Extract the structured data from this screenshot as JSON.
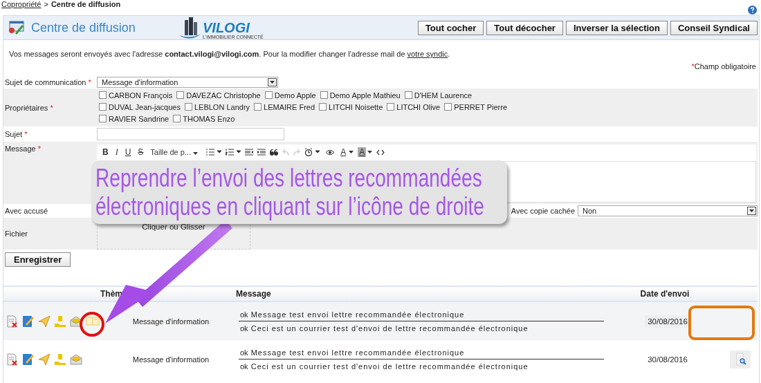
{
  "breadcrumb": {
    "parent": "Copropriété",
    "separator": ">",
    "current": "Centre de diffusion"
  },
  "header": {
    "title": "Centre de diffusion",
    "logo": {
      "name": "VILOGI",
      "tagline": "L'IMMOBILIER CONNECTÉ"
    },
    "buttons": [
      "Tout cocher",
      "Tout décocher",
      "Inverser la sélection",
      "Conseil Syndical"
    ]
  },
  "info": {
    "before": "Vos messages seront envoyés avec l'adresse ",
    "email": "contact.vilogi@vilogi.com",
    "after": ". Pour la modifier changer l'adresse mail de ",
    "link": "votre syndic",
    "end": "."
  },
  "required_note": {
    "star": "*",
    "text": "Champ obligatoire"
  },
  "form": {
    "subject_type": {
      "label": "Sujet de communication",
      "star": "*",
      "value": "Message d'information"
    },
    "owners": {
      "label": "Propriétaires",
      "star": "*",
      "items": [
        {
          "name": "CARBON François",
          "checked": false
        },
        {
          "name": "DAVEZAC Christophe",
          "checked": false
        },
        {
          "name": "Demo Apple",
          "checked": false
        },
        {
          "name": "Demo Apple Mathieu",
          "checked": false
        },
        {
          "name": "D'HEM Laurence",
          "checked": false
        },
        {
          "name": "DUVAL Jean-jacques",
          "checked": false
        },
        {
          "name": "LEBLON Landry",
          "checked": false
        },
        {
          "name": "LEMAIRE Fred",
          "checked": false
        },
        {
          "name": "LITCHI Noisette",
          "checked": false
        },
        {
          "name": "LITCHI Olive",
          "checked": false
        },
        {
          "name": "PERRET Pierre",
          "checked": false
        },
        {
          "name": "RAVIER Sandrine",
          "checked": false
        },
        {
          "name": "THOMAS Enzo",
          "checked": false
        }
      ]
    },
    "subject": {
      "label": "Sujet",
      "star": "*"
    },
    "message": {
      "label": "Message",
      "star": "*",
      "toolbar": [
        {
          "kind": "bold",
          "label": "B"
        },
        {
          "kind": "italic",
          "label": "I"
        },
        {
          "kind": "underline",
          "label": "U"
        },
        {
          "kind": "strike",
          "label": "S"
        },
        {
          "kind": "size",
          "label": "Taille de p..."
        },
        {
          "kind": "ul"
        },
        {
          "kind": "ol"
        },
        {
          "kind": "outdent"
        },
        {
          "kind": "indent"
        },
        {
          "kind": "quote"
        },
        {
          "kind": "undo",
          "disabled": true
        },
        {
          "kind": "redo",
          "disabled": true
        },
        {
          "kind": "clock"
        },
        {
          "kind": "eye"
        },
        {
          "kind": "color",
          "label": "A"
        },
        {
          "kind": "highlight",
          "label": "A"
        },
        {
          "kind": "code"
        }
      ]
    },
    "receipt": {
      "label": "Avec accusé"
    },
    "bcc": {
      "label": "Avec copie cachée",
      "value": "Non"
    },
    "file": {
      "label": "Fichier",
      "drop": "Cliquer ou Glisser"
    },
    "save": "Enregistrer"
  },
  "table": {
    "columns": [
      "Thèm",
      "Message",
      "Date d'envoi"
    ],
    "rows": [
      {
        "resend_available": true,
        "preview_available": false,
        "theme": "Message d'information",
        "lines": [
          {
            "status": "ok",
            "text": "Message test envoi lettre recommandée électronique"
          },
          {
            "status": "ok",
            "text": "Ceci est un courrier test d'envoi de lettre recommandée électronique"
          }
        ],
        "date": "30/08/2016"
      },
      {
        "resend_available": false,
        "preview_available": true,
        "theme": "Message d'information",
        "lines": [
          {
            "status": "ok",
            "text": "Message test envoi lettre recommandée électronique"
          },
          {
            "status": "ok",
            "text": "Ceci est un courrier test d'envoi de lettre recommandée électronique"
          }
        ],
        "date": "30/08/2016"
      }
    ]
  },
  "callout": {
    "lines": [
      "Reprendre l’envoi des lettres recommandées",
      "électroniques en cliquant sur l’icône de droite"
    ]
  }
}
